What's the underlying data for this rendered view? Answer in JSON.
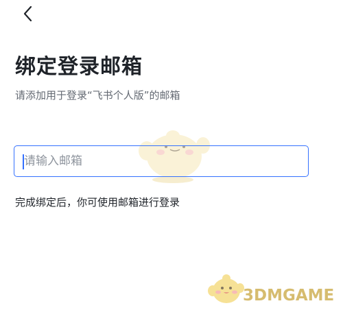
{
  "header": {
    "back_icon": "chevron-left-icon"
  },
  "main": {
    "title": "绑定登录邮箱",
    "subtitle": "请添加用于登录“飞书个人版”的邮箱",
    "email_input": {
      "value": "",
      "placeholder": "请输入邮箱"
    },
    "hint": "完成绑定后，你可使用邮箱进行登录"
  },
  "watermark": {
    "text": "3DMGAME",
    "color": "#c9a640"
  },
  "colors": {
    "accent": "#3370ff",
    "title": "#1f2329",
    "secondary": "#646a73",
    "placeholder": "#8f959e"
  }
}
